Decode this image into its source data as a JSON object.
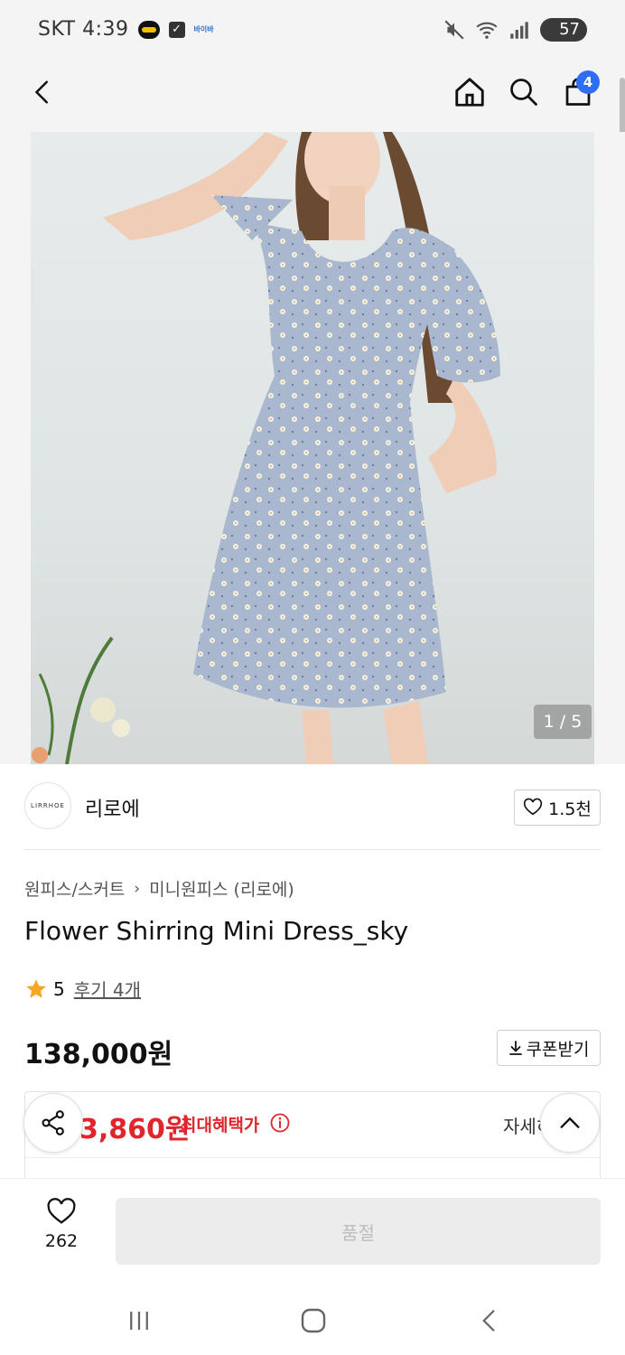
{
  "status_bar": {
    "carrier_time": "SKT 4:39",
    "battery": "57",
    "mini_text": "바이바"
  },
  "header": {
    "cart_badge": "4"
  },
  "gallery": {
    "counter": "1 / 5"
  },
  "brand": {
    "logo_text": "LIRRHOE",
    "name": "리로에",
    "likes": "1.5천"
  },
  "product": {
    "breadcrumb": [
      "원피스/스커트",
      "미니원피스 (리로에)"
    ],
    "title": "Flower Shirring Mini Dress_sky",
    "rating": "5",
    "review_link": "후기 4개",
    "price": "138,000원",
    "coupon_label": "쿠폰받기"
  },
  "benefit": {
    "price": "3,860원",
    "label": "최대혜택가",
    "detail_link": "자세히"
  },
  "bottom": {
    "wish_count": "262",
    "soldout_label": "품절"
  },
  "colors": {
    "accent_red": "#e0262c",
    "badge_blue": "#2f6df6",
    "star": "#f5a623"
  }
}
